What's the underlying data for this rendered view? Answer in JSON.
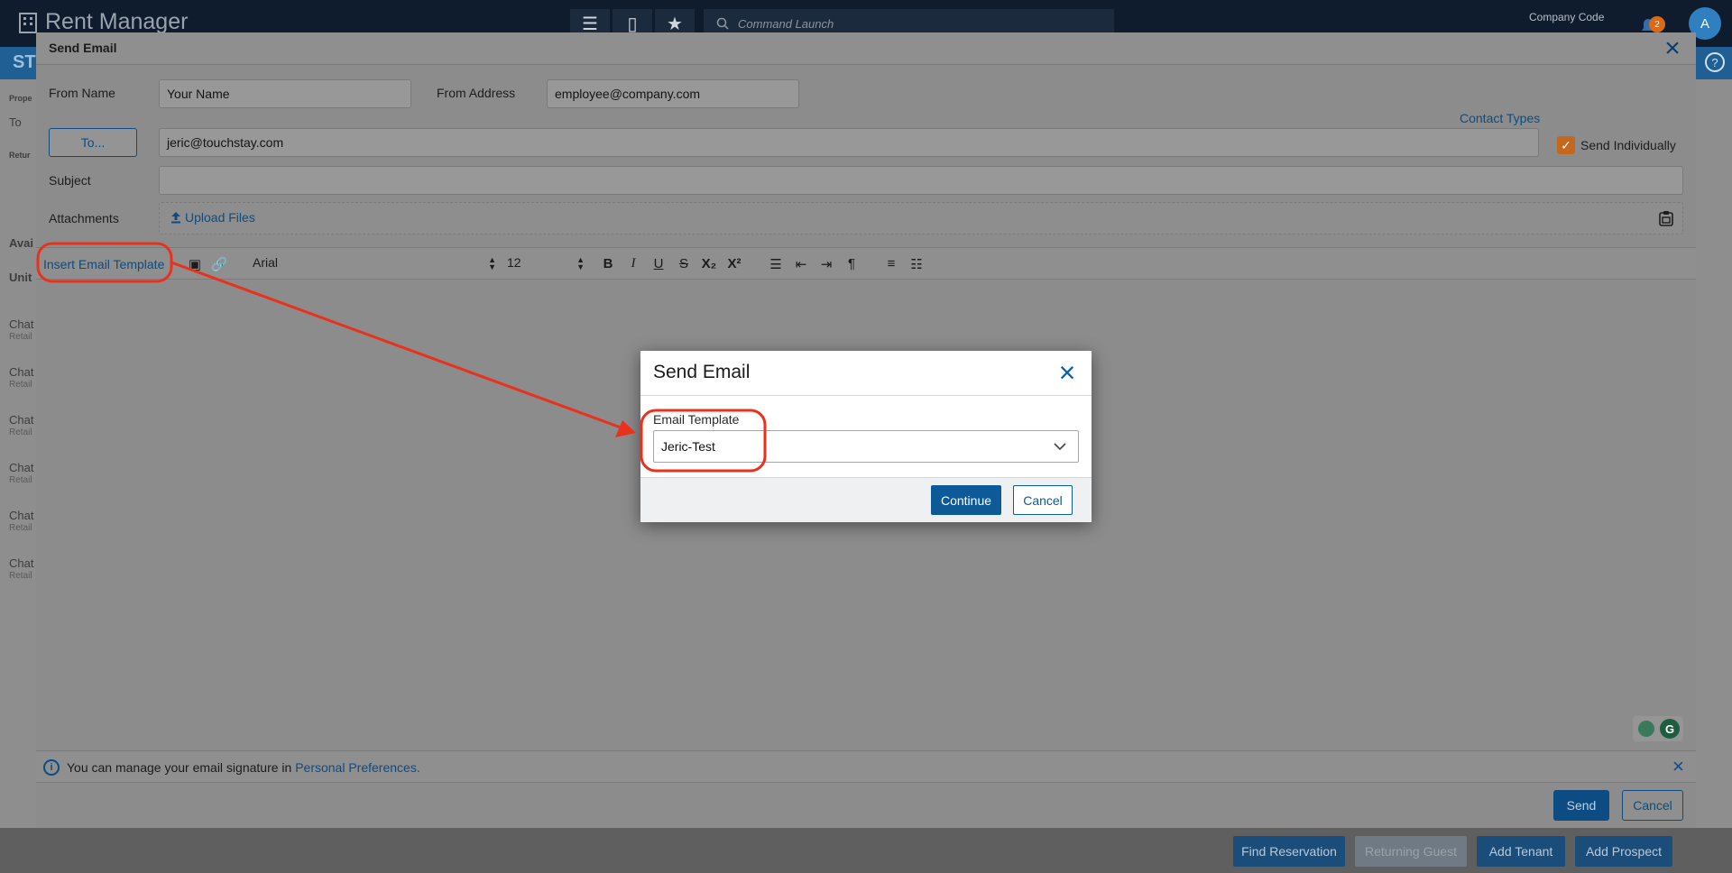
{
  "app": {
    "logo_text": "Rent Manager",
    "command_placeholder": "Command Launch",
    "company_code": "Company Code",
    "notification_count": "2",
    "avatar_initial": "A",
    "subbar_text": "ST"
  },
  "background": {
    "left_labels": [
      "Prope",
      "To",
      "Retur",
      "Avai",
      "Unit"
    ],
    "left_rows": [
      {
        "title": "Chat",
        "sub": "Retail"
      },
      {
        "title": "Chat",
        "sub": "Retail"
      },
      {
        "title": "Chat",
        "sub": "Retail"
      },
      {
        "title": "Chat",
        "sub": "Retail"
      },
      {
        "title": "Chat",
        "sub": "Retail"
      },
      {
        "title": "Chat",
        "sub": "Retail"
      }
    ],
    "bottom_buttons": [
      "Find Reservation",
      "Returning Guest",
      "Add Tenant",
      "Add Prospect"
    ]
  },
  "main_dialog": {
    "title": "Send Email",
    "from_name_label": "From Name",
    "from_name_value": "Your Name",
    "from_address_label": "From Address",
    "from_address_value": "employee@company.com",
    "contact_types_link": "Contact Types",
    "to_button": "To...",
    "to_value": "jeric@touchstay.com",
    "send_individually_label": "Send Individually",
    "send_individually_checked": true,
    "subject_label": "Subject",
    "subject_value": "",
    "attachments_label": "Attachments",
    "upload_files": "Upload Files",
    "toolbar": {
      "insert_template": "Insert Email Template",
      "font_family": "Arial",
      "font_size": "12"
    },
    "signature_notice_prefix": "You can manage your email signature in ",
    "signature_notice_link": "Personal Preferences.",
    "send_button": "Send",
    "cancel_button": "Cancel"
  },
  "template_modal": {
    "title": "Send Email",
    "field_label": "Email Template",
    "selected_template": "Jeric-Test",
    "continue_button": "Continue",
    "cancel_button": "Cancel"
  },
  "colors": {
    "annotation_red": "#e8321e",
    "primary_blue": "#0d5a98",
    "checkbox_orange": "#c4681e"
  }
}
